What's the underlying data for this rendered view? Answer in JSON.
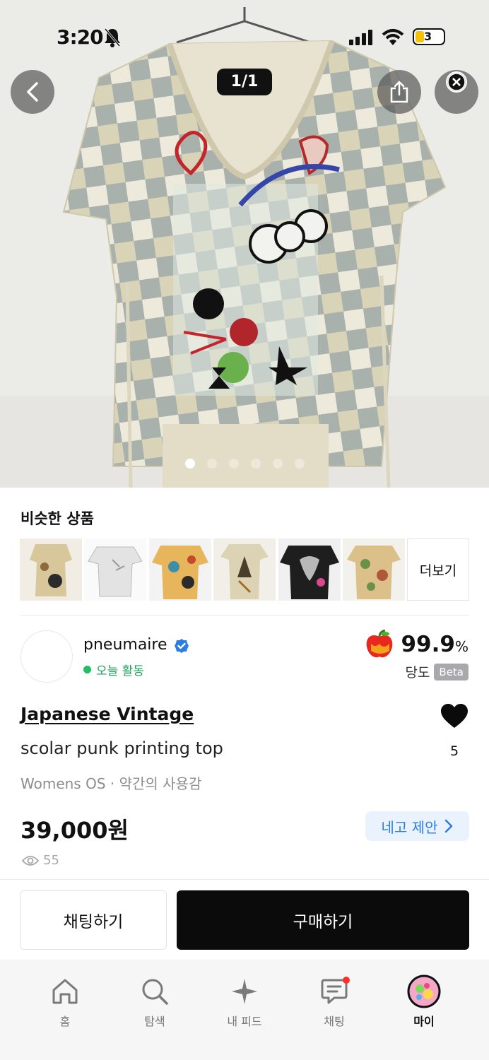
{
  "status_bar": {
    "time": "3:20",
    "battery": "3"
  },
  "gallery": {
    "counter": "1/1",
    "dots": 6,
    "active_dot": 0
  },
  "similar": {
    "title": "비슷한 상품",
    "more_label": "더보기",
    "thumbs": [
      "thumb-1",
      "thumb-2",
      "thumb-3",
      "thumb-4",
      "thumb-5",
      "thumb-6"
    ]
  },
  "seller": {
    "name": "pneumaire",
    "activity": "오늘 활동",
    "score": "99.9",
    "score_unit": "%",
    "score_label": "당도",
    "beta": "Beta"
  },
  "product": {
    "brand": "Japanese Vintage",
    "name": "scolar punk printing top",
    "meta": "Womens OS · 약간의 사용감",
    "likes": "5",
    "price": "39,000원",
    "offer_label": "네고 제안",
    "views": "55"
  },
  "actions": {
    "chat": "채팅하기",
    "buy": "구매하기"
  },
  "tabbar": {
    "tabs": [
      {
        "label": "홈",
        "icon": "home-icon"
      },
      {
        "label": "탐색",
        "icon": "search-icon"
      },
      {
        "label": "내 피드",
        "icon": "sparkle-icon"
      },
      {
        "label": "채팅",
        "icon": "chat-icon"
      },
      {
        "label": "마이",
        "icon": "profile-avatar-icon"
      }
    ],
    "active": 4
  },
  "colors": {
    "accent_blue": "#2a7de1",
    "online_green": "#1fbf63",
    "badge_red": "#ff2d2d"
  }
}
